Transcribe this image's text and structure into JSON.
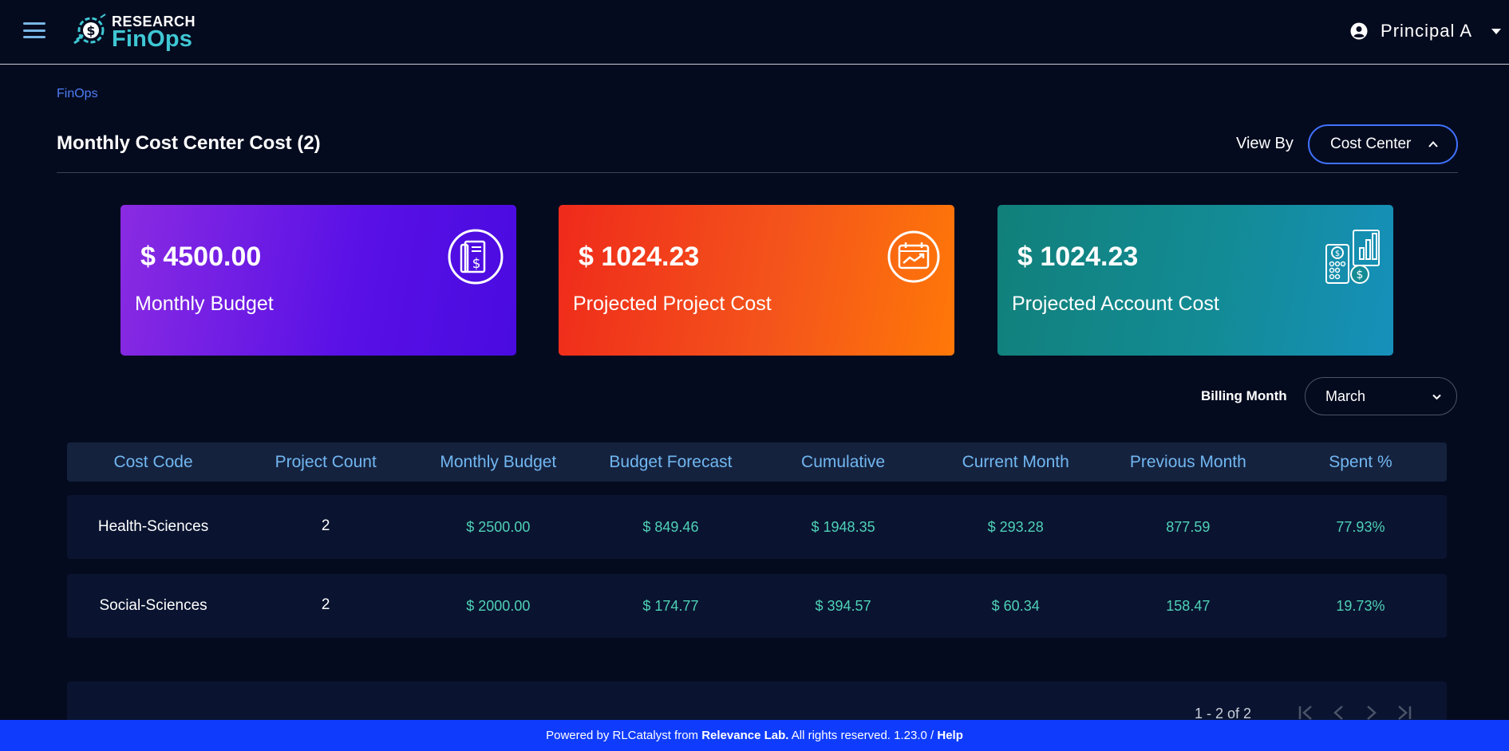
{
  "header": {
    "logo_top": "RESEARCH",
    "logo_bottom": "FinOps",
    "user_name": "Principal A"
  },
  "breadcrumb": "FinOps",
  "page": {
    "title": "Monthly Cost Center Cost (2)",
    "view_by_label": "View By",
    "view_by_value": "Cost Center"
  },
  "cards": [
    {
      "amount": "$ 4500.00",
      "label": "Monthly Budget",
      "icon": "receipt-dollar-icon"
    },
    {
      "amount": "$ 1024.23",
      "label": "Projected Project Cost",
      "icon": "calendar-trend-icon"
    },
    {
      "amount": "$ 1024.23",
      "label": "Projected Account Cost",
      "icon": "calculator-chart-icon"
    }
  ],
  "billing": {
    "label": "Billing Month",
    "value": "March"
  },
  "table": {
    "headers": [
      "Cost Code",
      "Project Count",
      "Monthly Budget",
      "Budget Forecast",
      "Cumulative",
      "Current Month",
      "Previous Month",
      "Spent %"
    ],
    "rows": [
      [
        "Health-Sciences",
        "2",
        "$ 2500.00",
        "$ 849.46",
        "$ 1948.35",
        "$ 293.28",
        "877.59",
        "77.93%"
      ],
      [
        "Social-Sciences",
        "2",
        "$ 2000.00",
        "$ 174.77",
        "$ 394.57",
        "$ 60.34",
        "158.47",
        "19.73%"
      ]
    ]
  },
  "pagination": {
    "range": "1 - 2 of 2"
  },
  "footer": {
    "prefix": "Powered by RLCatalyst from ",
    "company": "Relevance Lab.",
    "middle": " All rights reserved. 1.23.0 / ",
    "help": "Help"
  },
  "colors": {
    "background": "#050b1f",
    "accent_blue": "#3f72ff",
    "table_header_text": "#71b7f1",
    "table_value_text": "#4fd1b7",
    "footer": "#0f3cfc"
  }
}
